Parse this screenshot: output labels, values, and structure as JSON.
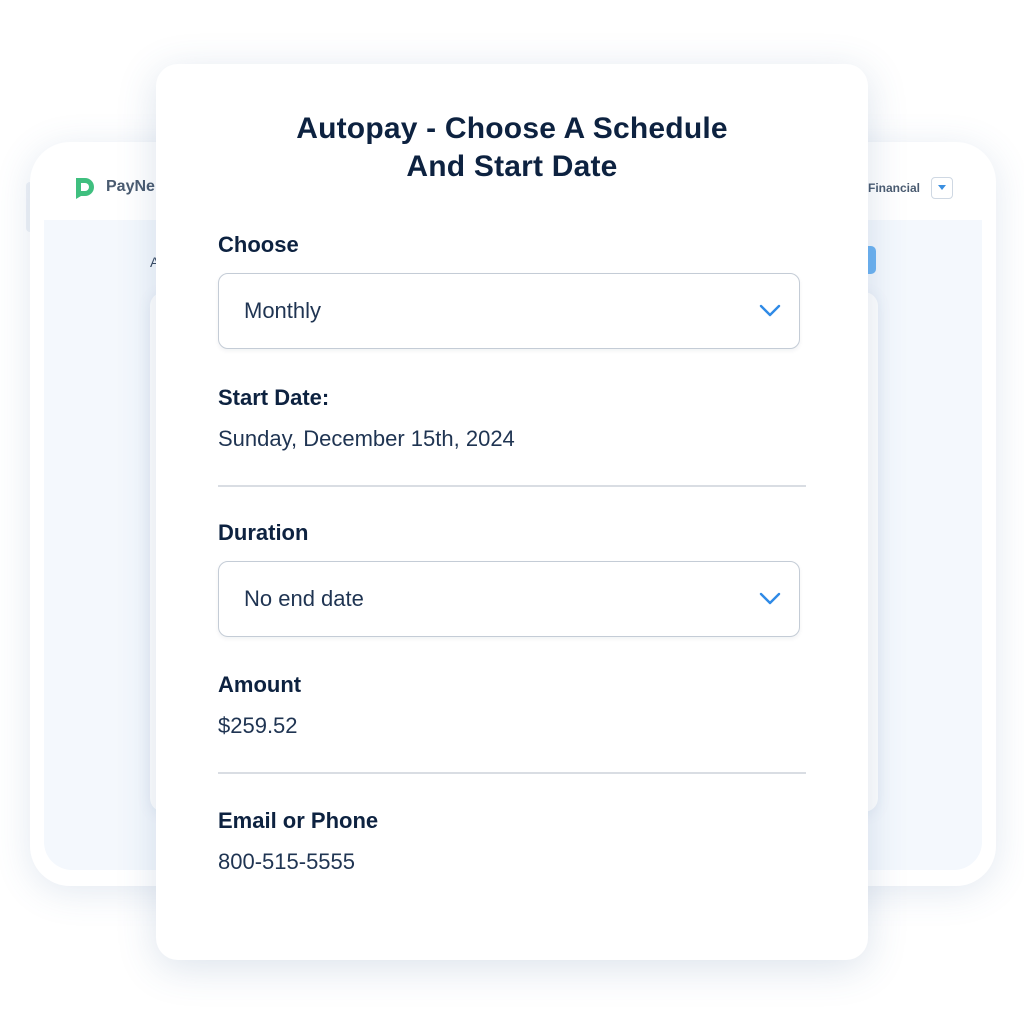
{
  "background_app": {
    "brand_name": "PayNe",
    "org_name": "Financial",
    "stub_letter": "A",
    "accent_color": "#6db3f2",
    "brand_color": "#3fbf7f"
  },
  "modal": {
    "title_line1": "Autopay - Choose A Schedule",
    "title_line2": "And Start Date",
    "schedule": {
      "label": "Choose",
      "value": "Monthly"
    },
    "start_date": {
      "label": "Start Date:",
      "value": "Sunday, December 15th, 2024"
    },
    "duration": {
      "label": "Duration",
      "value": "No end date"
    },
    "amount": {
      "label": "Amount",
      "value": "$259.52"
    },
    "contact": {
      "label": "Email or Phone",
      "value": "800-515-5555"
    }
  },
  "icons": {
    "select_chevron": "chevron-down-icon",
    "brand": "paynearme-logo-icon",
    "header_caret": "caret-down-icon"
  }
}
